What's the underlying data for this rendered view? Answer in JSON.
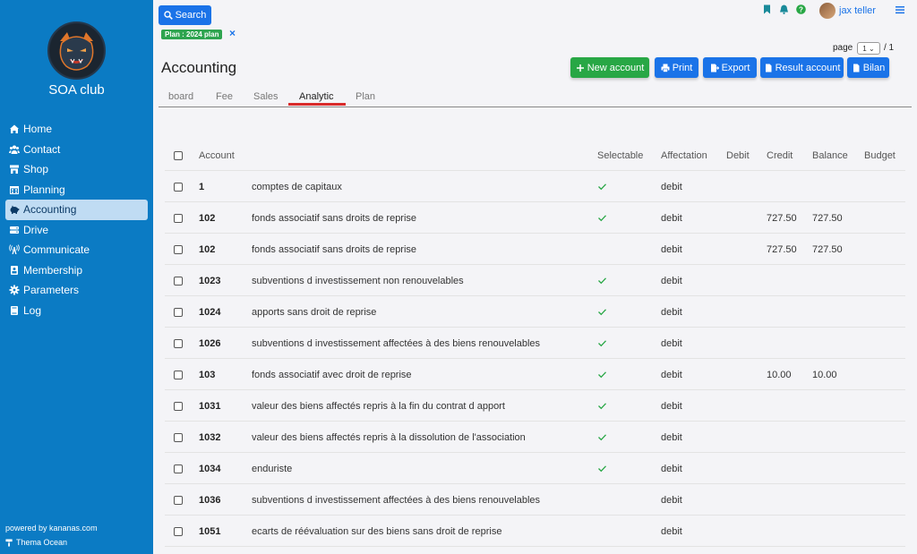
{
  "colors": {
    "sidebar": "#0b7bc4",
    "primary": "#1a73e8",
    "success": "#28a745",
    "tab_active": "#d92b2b"
  },
  "sidebar": {
    "club_name": "SOA club",
    "items": [
      {
        "label": "Home",
        "icon": "home-icon"
      },
      {
        "label": "Contact",
        "icon": "users-icon"
      },
      {
        "label": "Shop",
        "icon": "store-icon"
      },
      {
        "label": "Planning",
        "icon": "calendar-icon"
      },
      {
        "label": "Accounting",
        "icon": "piggy-bank-icon",
        "active": true
      },
      {
        "label": "Drive",
        "icon": "drive-icon"
      },
      {
        "label": "Communicate",
        "icon": "broadcast-icon"
      },
      {
        "label": "Membership",
        "icon": "id-card-icon"
      },
      {
        "label": "Parameters",
        "icon": "gear-icon"
      },
      {
        "label": "Log",
        "icon": "book-icon"
      }
    ],
    "powered": "powered by kananas.com",
    "theme": "Thema Ocean"
  },
  "header": {
    "search_label": "Search",
    "plan_tag": "Plan : 2024 plan",
    "user_name": "jax teller",
    "page_label": "page",
    "page_value": "1",
    "page_total": "/ 1"
  },
  "title": "Accounting",
  "buttons": {
    "new_account": "New account",
    "print": "Print",
    "export": "Export",
    "result_account": "Result account",
    "bilan": "Bilan"
  },
  "tabs": [
    "board",
    "Fee",
    "Sales",
    "Analytic",
    "Plan"
  ],
  "active_tab": "Analytic",
  "table": {
    "headers": {
      "account": "Account",
      "selectable": "Selectable",
      "affectation": "Affectation",
      "debit": "Debit",
      "credit": "Credit",
      "balance": "Balance",
      "budget": "Budget"
    },
    "rows": [
      {
        "account": "1",
        "label": "comptes de capitaux",
        "selectable": true,
        "affectation": "debit",
        "credit": "",
        "balance": ""
      },
      {
        "account": "102",
        "label": "fonds associatif sans droits de reprise",
        "selectable": true,
        "affectation": "debit",
        "credit": "727.50",
        "balance": "727.50"
      },
      {
        "account": "102",
        "label": "fonds associatif sans droits de reprise",
        "selectable": false,
        "affectation": "debit",
        "credit": "727.50",
        "balance": "727.50"
      },
      {
        "account": "1023",
        "label": "subventions d investissement non renouvelables",
        "selectable": true,
        "affectation": "debit",
        "credit": "",
        "balance": ""
      },
      {
        "account": "1024",
        "label": "apports sans droit de reprise",
        "selectable": true,
        "affectation": "debit",
        "credit": "",
        "balance": ""
      },
      {
        "account": "1026",
        "label": "subventions d investissement affectées à des biens renouvelables",
        "selectable": true,
        "affectation": "debit",
        "credit": "",
        "balance": ""
      },
      {
        "account": "103",
        "label": "fonds associatif avec droit de reprise",
        "selectable": true,
        "affectation": "debit",
        "credit": "10.00",
        "balance": "10.00"
      },
      {
        "account": "1031",
        "label": "valeur des biens affectés repris à la fin du contrat d apport",
        "selectable": true,
        "affectation": "debit",
        "credit": "",
        "balance": ""
      },
      {
        "account": "1032",
        "label": "valeur des biens affectés repris à la dissolution de l'association",
        "selectable": true,
        "affectation": "debit",
        "credit": "",
        "balance": ""
      },
      {
        "account": "1034",
        "label": "enduriste",
        "selectable": true,
        "affectation": "debit",
        "credit": "",
        "balance": ""
      },
      {
        "account": "1036",
        "label": "subventions d investissement affectées à des biens renouvelables",
        "selectable": false,
        "affectation": "debit",
        "credit": "",
        "balance": ""
      },
      {
        "account": "1051",
        "label": "ecarts de réévaluation sur des biens sans droit de reprise",
        "selectable": false,
        "affectation": "debit",
        "credit": "",
        "balance": ""
      }
    ]
  }
}
